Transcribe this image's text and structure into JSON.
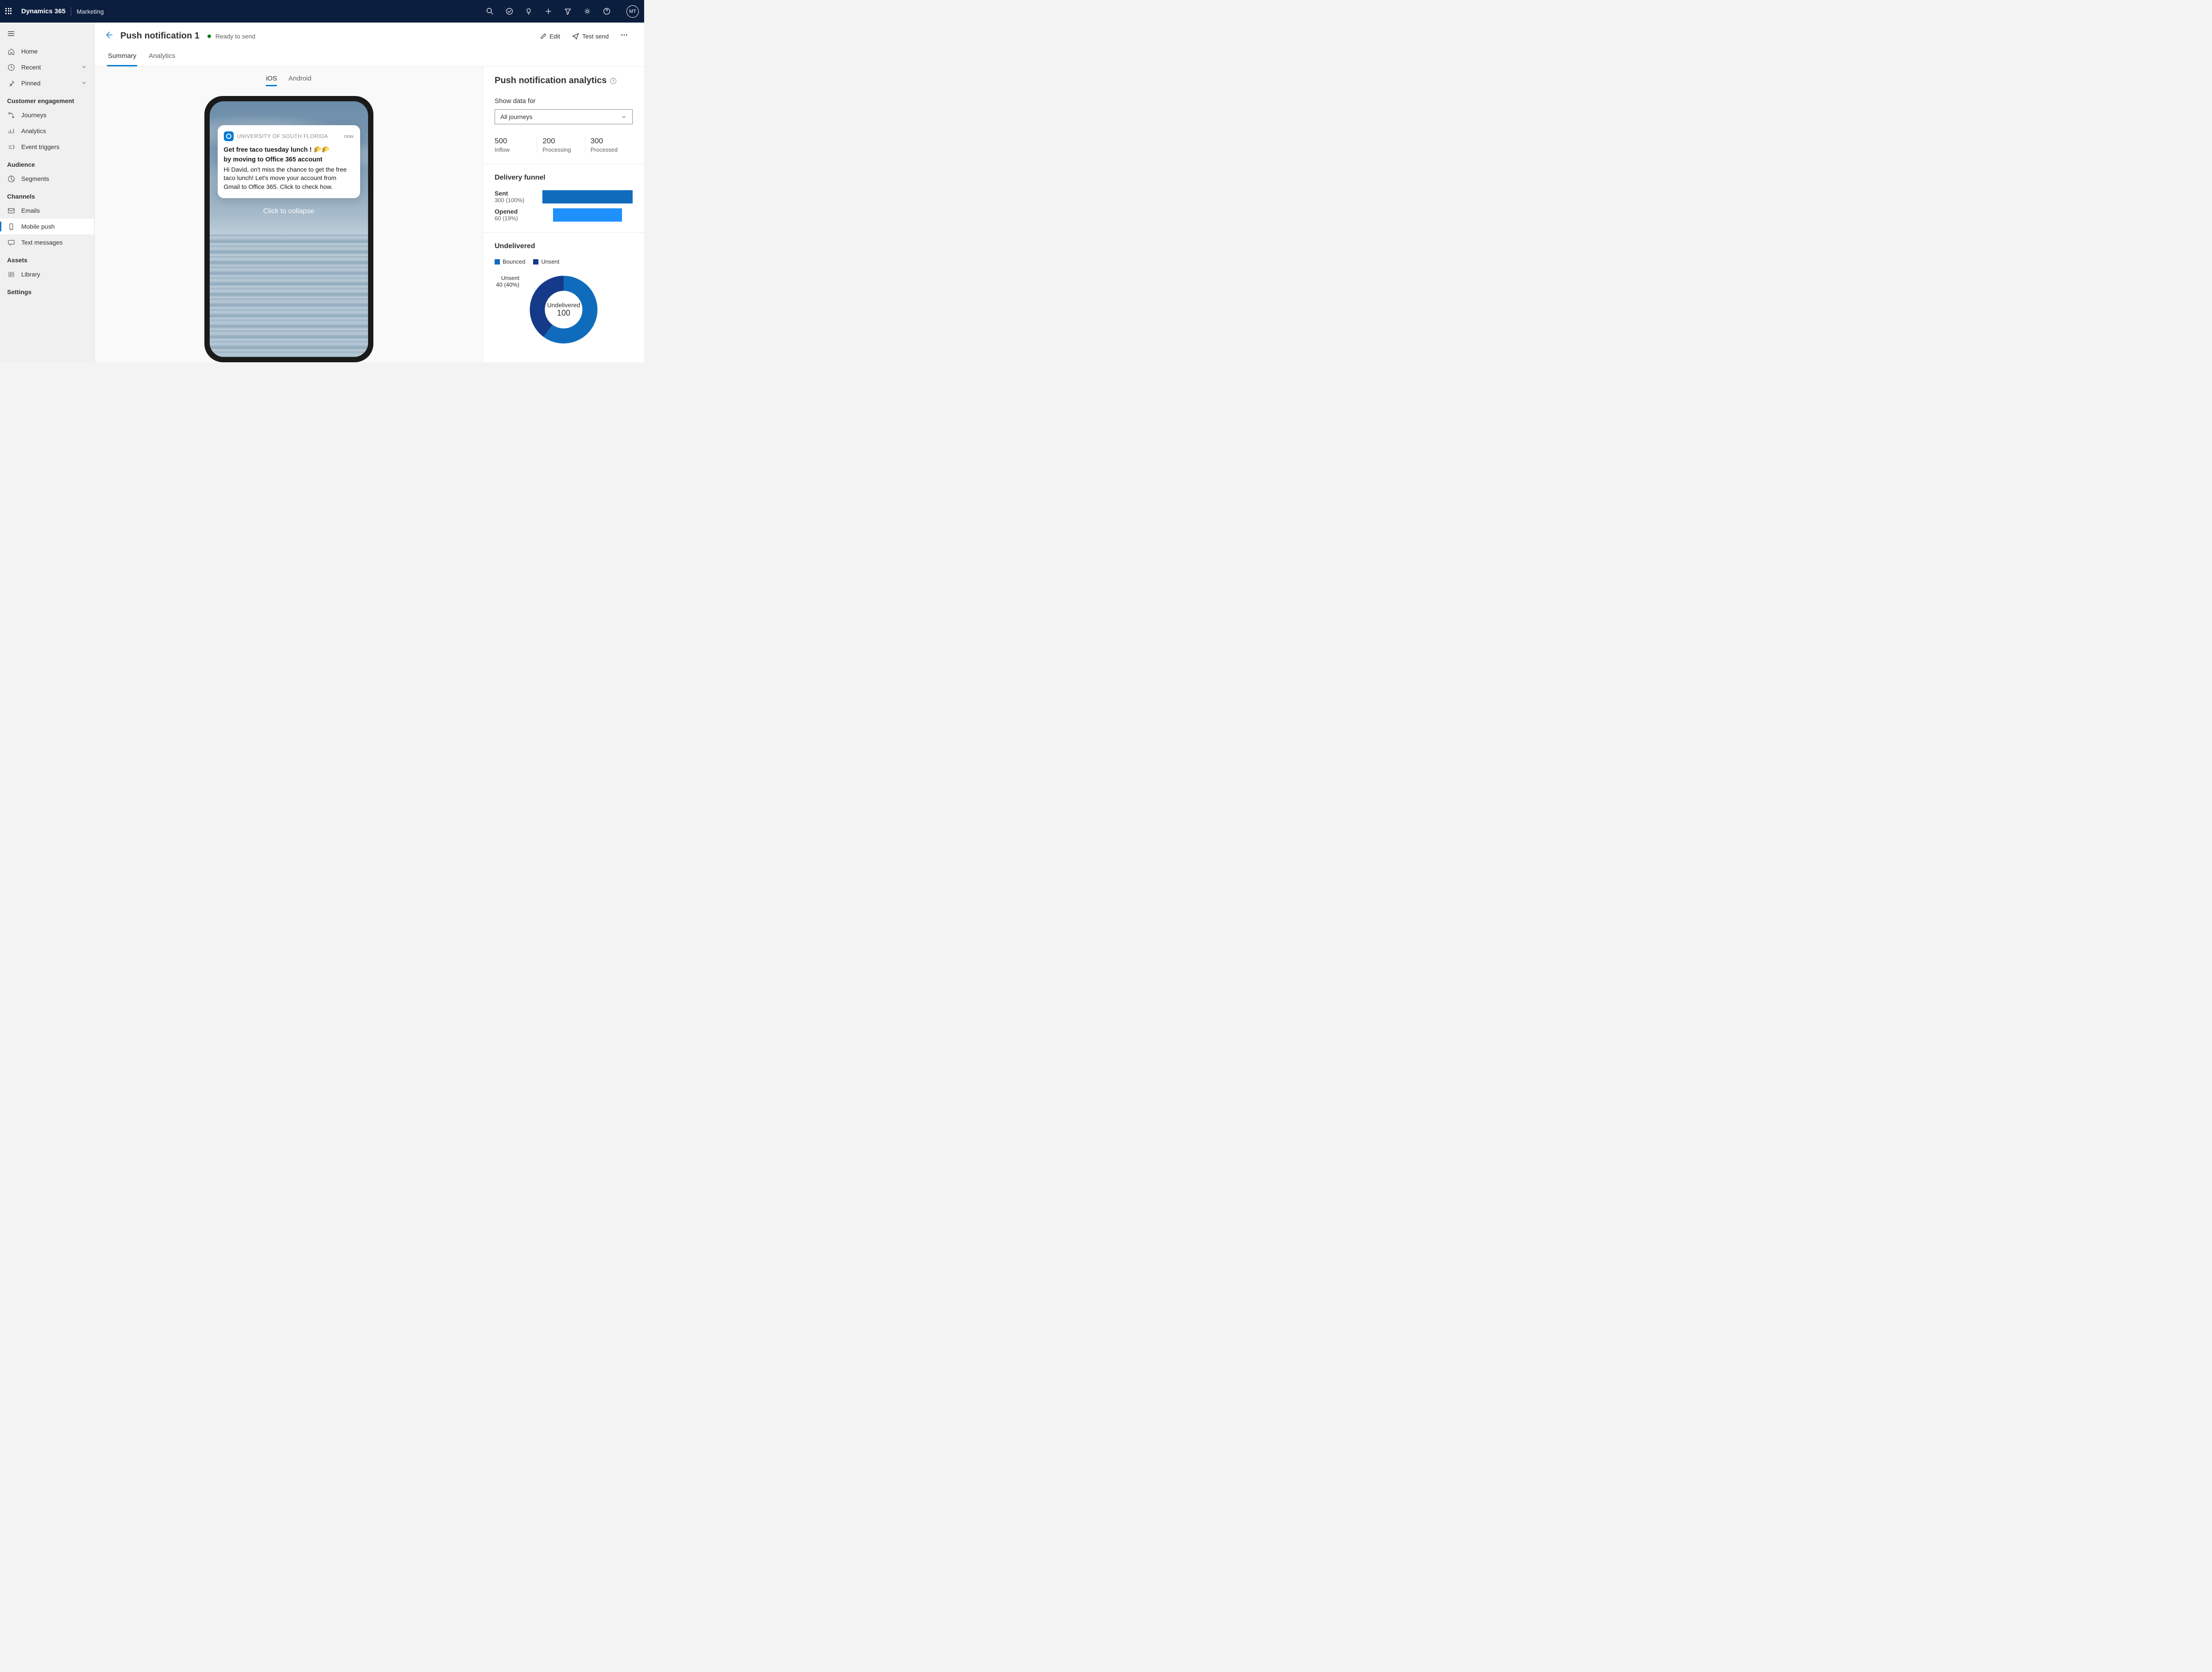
{
  "topbar": {
    "brand": "Dynamics 365",
    "subbrand": "Marketing",
    "avatar": "MT"
  },
  "sidebar": {
    "home": "Home",
    "recent": "Recent",
    "pinned": "Pinned",
    "sections": {
      "customer_engagement": "Customer engagement",
      "audience": "Audience",
      "channels": "Channels",
      "assets": "Assets",
      "settings": "Settings"
    },
    "items": {
      "journeys": "Journeys",
      "analytics": "Analytics",
      "event_triggers": "Event triggers",
      "segments": "Segments",
      "emails": "Emails",
      "mobile_push": "Mobile push",
      "text_messages": "Text messages",
      "library": "Library"
    }
  },
  "header": {
    "title": "Push notification 1",
    "status": "Ready to send",
    "edit": "Edit",
    "test_send": "Test send"
  },
  "tabs": {
    "summary": "Summary",
    "analytics": "Analytics"
  },
  "device_tabs": {
    "ios": "iOS",
    "android": "Android"
  },
  "notification": {
    "app_name": "UNIVERSITY OF SOUTH FLORIDA",
    "time": "now",
    "title_line1": "Get free taco tuesday lunch ! 🌮🌮",
    "title_line2": "by moving to Office 365 account",
    "body": "Hi David, on't miss the chance to get the free taco lunch! Let's move your account from Gmail to Office 365. Click to check how.",
    "collapse": "Click to collapse"
  },
  "analytics": {
    "title": "Push notification analytics",
    "show_data_for": "Show data for",
    "dropdown_value": "All journeys",
    "kpis": {
      "inflow": {
        "value": "500",
        "label": "Inflow"
      },
      "processing": {
        "value": "200",
        "label": "Processing"
      },
      "processed": {
        "value": "300",
        "label": "Processed"
      }
    },
    "delivery_funnel": {
      "heading": "Delivery funnel",
      "sent": {
        "name": "Sent",
        "count": "300 (100%)",
        "pct": 100
      },
      "opened": {
        "name": "Opened",
        "count": "60 (19%)",
        "pct": 76
      }
    },
    "undelivered": {
      "heading": "Undelivered",
      "legend": {
        "bounced": "Bounced",
        "unsent": "Unsent"
      },
      "unsent_label": "Unsent",
      "unsent_count": "40 (40%)",
      "center_label": "Undelivered",
      "center_value": "100"
    }
  },
  "chart_data": [
    {
      "type": "bar",
      "title": "Delivery funnel",
      "categories": [
        "Sent",
        "Opened"
      ],
      "values": [
        300,
        60
      ],
      "percentages": [
        100,
        19
      ],
      "orientation": "horizontal"
    },
    {
      "type": "pie",
      "title": "Undelivered",
      "series": [
        {
          "name": "Bounced",
          "value": 60,
          "color": "#0f6cbd"
        },
        {
          "name": "Unsent",
          "value": 40,
          "color": "#153a8a"
        }
      ],
      "total_label": "Undelivered",
      "total_value": 100
    }
  ]
}
